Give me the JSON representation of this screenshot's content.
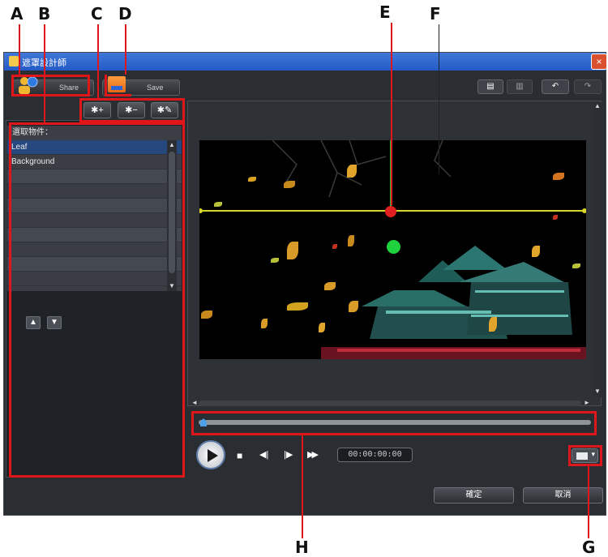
{
  "callouts": {
    "A": "A",
    "B": "B",
    "C": "C",
    "D": "D",
    "E": "E",
    "F": "F",
    "G": "G",
    "H": "H"
  },
  "window": {
    "title": "遮罩設計師",
    "close_glyph": "×"
  },
  "toolbar": {
    "share_label": "Share",
    "save_label": "Save",
    "add_glyph": "✱+",
    "remove_glyph": "✱−",
    "edit_glyph": "✱✎"
  },
  "top_right": {
    "copy_glyph": "▤",
    "paste_glyph": "▥",
    "undo_glyph": "↶",
    "redo_glyph": "↷"
  },
  "object_list": {
    "header": "選取物件：",
    "items": [
      "Leaf",
      "Background",
      "",
      "",
      "",
      "",
      "",
      "",
      "",
      ""
    ]
  },
  "move": {
    "up_glyph": "▲",
    "down_glyph": "▼"
  },
  "scroll": {
    "up": "▲",
    "down": "▼",
    "left": "◄",
    "right": "►"
  },
  "playback": {
    "timecode": "00:00:00:00",
    "stop_glyph": "■",
    "prev_glyph": "◀|",
    "next_glyph": "|▶",
    "fast_glyph": "▶▶"
  },
  "footer": {
    "ok_label": "確定",
    "cancel_label": "取消"
  },
  "colors": {
    "annotation": "#e0161b",
    "guide_horizontal": "#d9d62a",
    "guide_vertical": "#25c442",
    "dot_red": "#e02020",
    "dot_green": "#1fd13c"
  }
}
